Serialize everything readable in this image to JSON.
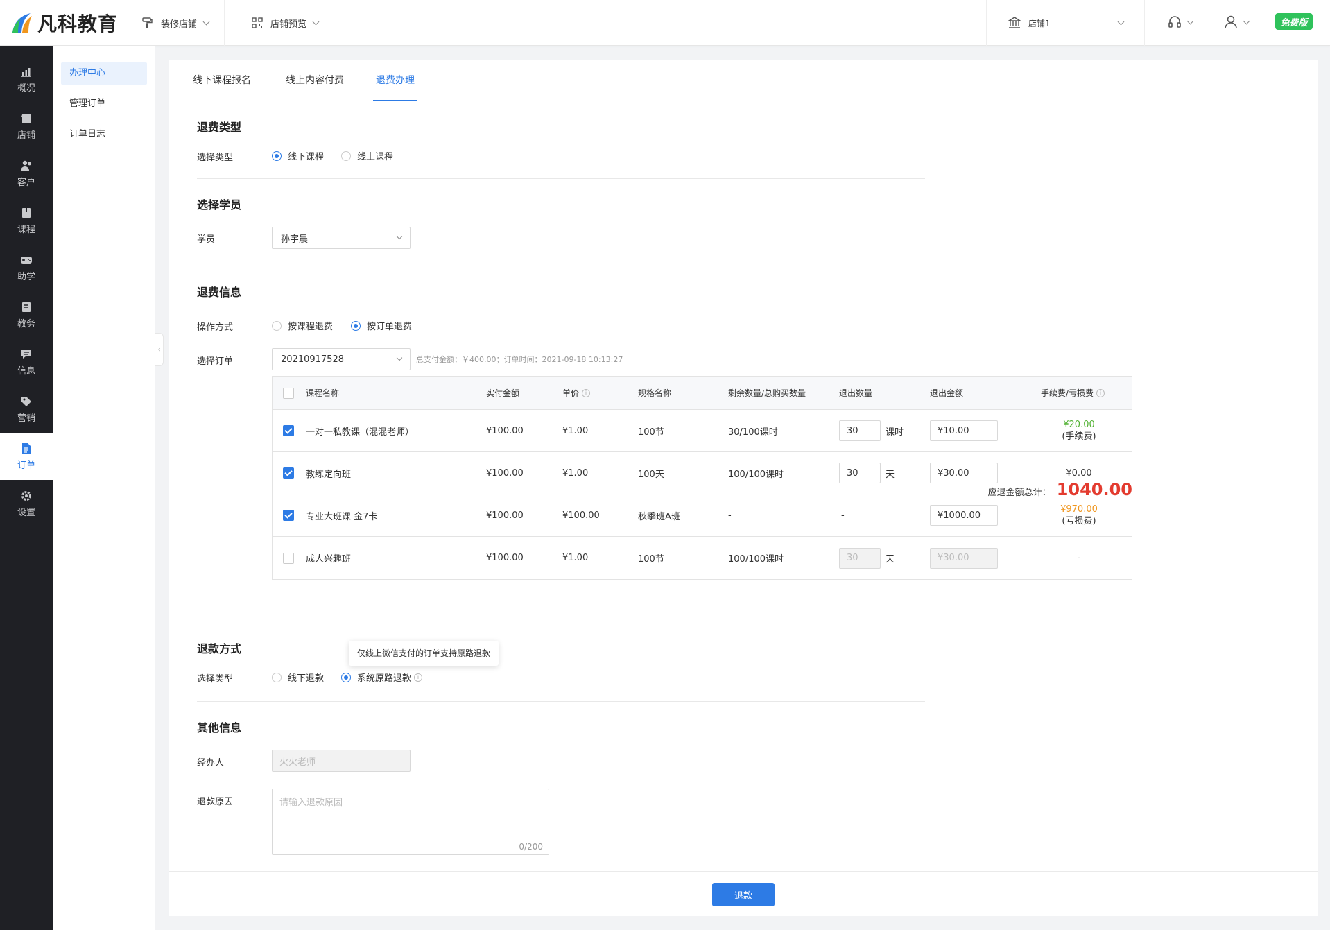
{
  "brand": {
    "name": "凡科教育"
  },
  "topbar": {
    "decorate_label": "装修店铺",
    "preview_label": "店铺预览",
    "store_label": "店铺1",
    "free_badge": "免费版"
  },
  "leftnav": {
    "items": [
      {
        "label": "概况",
        "icon": "chart-icon"
      },
      {
        "label": "店铺",
        "icon": "store-icon"
      },
      {
        "label": "客户",
        "icon": "users-icon"
      },
      {
        "label": "课程",
        "icon": "book-icon"
      },
      {
        "label": "助学",
        "icon": "gamepad-icon"
      },
      {
        "label": "教务",
        "icon": "notebook-icon"
      },
      {
        "label": "信息",
        "icon": "message-icon"
      },
      {
        "label": "营销",
        "icon": "tag-icon"
      },
      {
        "label": "订单",
        "icon": "order-icon"
      },
      {
        "label": "设置",
        "icon": "gear-icon"
      }
    ],
    "active": "订单"
  },
  "subnav": {
    "items": [
      "办理中心",
      "管理订单",
      "订单日志"
    ],
    "active": "办理中心"
  },
  "tabs": [
    "线下课程报名",
    "线上内容付费",
    "退费办理"
  ],
  "active_tab": "退费办理",
  "refund_type": {
    "title": "退费类型",
    "label": "选择类型",
    "options": [
      "线下课程",
      "线上课程"
    ],
    "selected": "线下课程"
  },
  "student": {
    "title": "选择学员",
    "label": "学员",
    "value": "孙宇晨"
  },
  "refund_info": {
    "title": "退费信息",
    "mode_label": "操作方式",
    "mode_options": [
      "按课程退费",
      "按订单退费"
    ],
    "mode_selected": "按订单退费",
    "order_label": "选择订单",
    "order_value": "20210917528",
    "order_meta": "总支付金额：￥400.00；订单时间：2021-09-18 10:13:27"
  },
  "table": {
    "headers": [
      "课程名称",
      "实付金额",
      "单价",
      "规格名称",
      "剩余数量/总购买数量",
      "退出数量",
      "退出金额",
      "手续费/亏损费"
    ],
    "rows": [
      {
        "checked": true,
        "name": "一对一私教课（混混老师）",
        "paid": "¥100.00",
        "price": "¥1.00",
        "spec": "100节",
        "remain": "30/100课时",
        "qty": "30",
        "unit": "课时",
        "amount": "¥10.00",
        "fee": "¥20.00",
        "fee_note": "(手续费)",
        "fee_color": "#52b233",
        "disabled": false
      },
      {
        "checked": true,
        "name": "教练定向班",
        "paid": "¥100.00",
        "price": "¥1.00",
        "spec": "100天",
        "remain": "100/100课时",
        "qty": "30",
        "unit": "天",
        "amount": "¥30.00",
        "fee": "¥0.00",
        "fee_note": "",
        "fee_color": "#333333",
        "disabled": false
      },
      {
        "checked": true,
        "name": "专业大班课 金7卡",
        "paid": "¥100.00",
        "price": "¥100.00",
        "spec": "秋季班A班",
        "remain": "-",
        "qty": "-",
        "unit": "",
        "amount": "¥1000.00",
        "fee": "¥970.00",
        "fee_note": "(亏损费)",
        "fee_color": "#f0961e",
        "disabled": false
      },
      {
        "checked": false,
        "name": "成人兴趣班",
        "paid": "¥100.00",
        "price": "¥1.00",
        "spec": "100节",
        "remain": "100/100课时",
        "qty": "30",
        "unit": "天",
        "amount": "¥30.00",
        "fee": "-",
        "fee_note": "",
        "fee_color": "#333333",
        "disabled": true
      }
    ]
  },
  "total": {
    "label": "应退金额总计：",
    "value": "1040.00"
  },
  "refund_method": {
    "title": "退款方式",
    "label": "选择类型",
    "options": [
      "线下退款",
      "系统原路退款"
    ],
    "selected": "系统原路退款",
    "tooltip": "仅线上微信支付的订单支持原路退款"
  },
  "other": {
    "title": "其他信息",
    "handler_label": "经办人",
    "handler_placeholder": "火火老师",
    "reason_label": "退款原因",
    "reason_placeholder": "请输入退款原因",
    "counter": "0/200"
  },
  "submit_label": "退款",
  "colors": {
    "accent": "#2d7be5",
    "total": "#e33b2f",
    "sidebar": "#1f2025",
    "badge": "#2fc25b"
  }
}
